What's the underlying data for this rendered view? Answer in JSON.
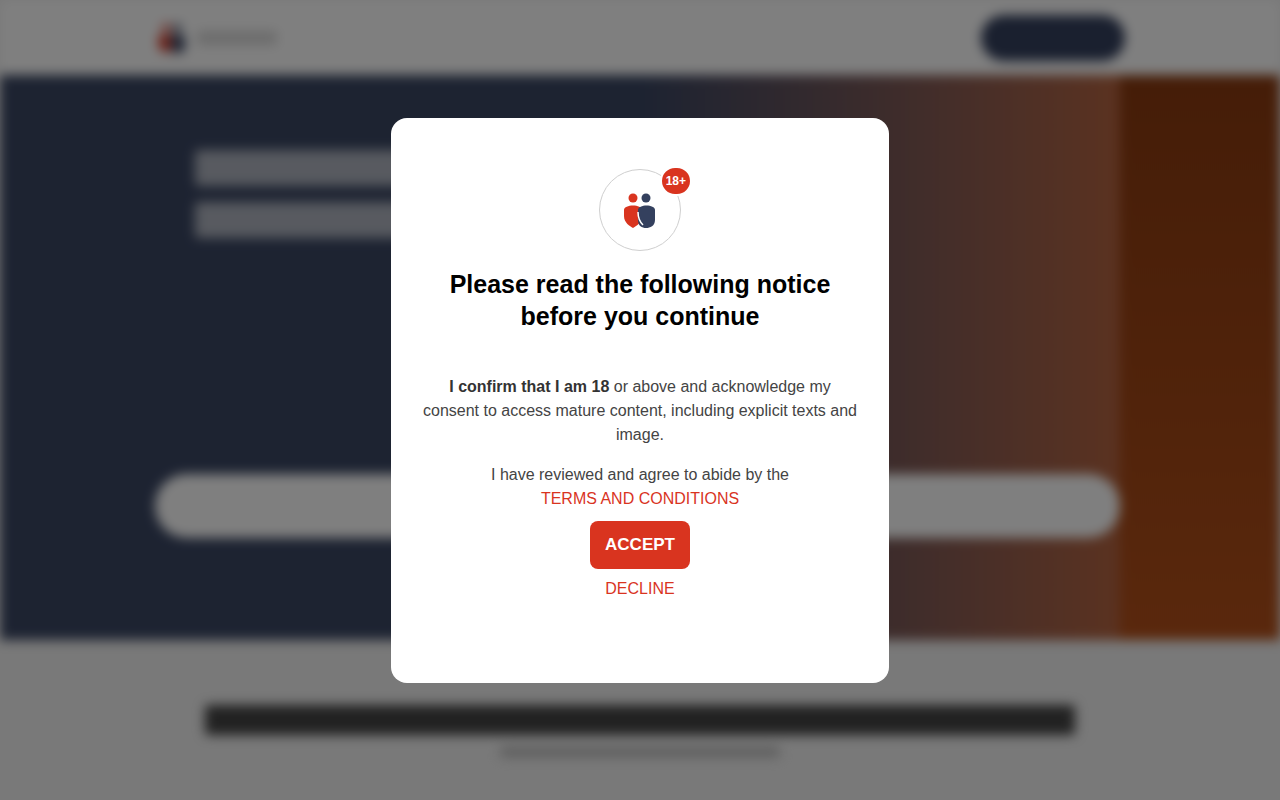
{
  "dialog": {
    "badge": "18+",
    "title": "Please read the following notice before you continue",
    "notice_bold": "I confirm that I am 18",
    "notice_rest": " or above and acknowledge my consent to access mature content, including explicit texts and image.",
    "agree_text": "I have reviewed and agree to abide by the",
    "terms_link": "TERMS AND CONDITIONS",
    "buttons": [
      "ACCEPT",
      "DECLINE"
    ]
  }
}
